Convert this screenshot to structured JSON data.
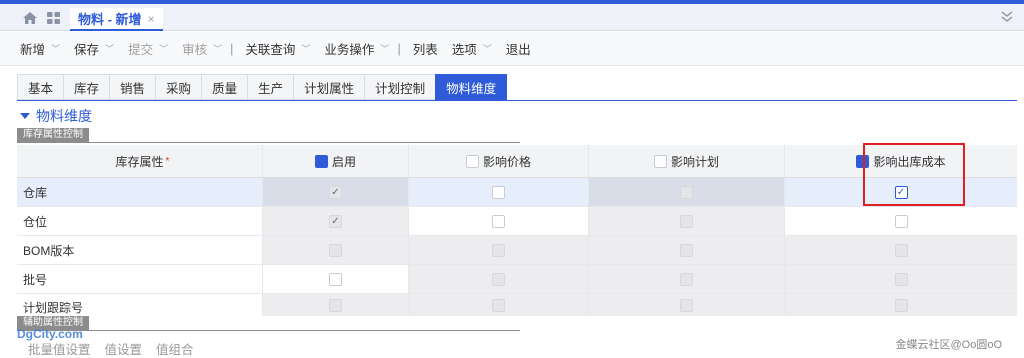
{
  "tabbar": {
    "doc_tab": "物料 - 新增",
    "close": "×"
  },
  "toolbar": [
    {
      "label": "新增",
      "dropdown": true,
      "disabled": false
    },
    {
      "label": "保存",
      "dropdown": true,
      "disabled": false
    },
    {
      "label": "提交",
      "dropdown": true,
      "disabled": true
    },
    {
      "label": "审核",
      "dropdown": true,
      "disabled": true
    },
    {
      "label": "关联查询",
      "dropdown": true,
      "disabled": false
    },
    {
      "label": "业务操作",
      "dropdown": true,
      "disabled": false
    },
    {
      "label": "列表",
      "dropdown": false,
      "disabled": false
    },
    {
      "label": "选项",
      "dropdown": true,
      "disabled": false
    },
    {
      "label": "退出",
      "dropdown": false,
      "disabled": false
    }
  ],
  "toolbar_sep": "|",
  "subtabs": [
    "基本",
    "库存",
    "销售",
    "采购",
    "质量",
    "生产",
    "计划属性",
    "计划控制",
    "物料维度"
  ],
  "active_subtab": "物料维度",
  "section_title": "物料维度",
  "group_inventory": "库存属性控制",
  "group_aux": "辅助属性控制",
  "grid": {
    "columns": [
      "库存属性",
      "启用",
      "影响价格",
      "影响计划",
      "影响出库成本"
    ],
    "required_mark": "*",
    "rows": [
      {
        "name": "仓库",
        "enabled": "checked-dis",
        "price": "empty",
        "plan": "dis",
        "cost": "checked"
      },
      {
        "name": "仓位",
        "enabled": "checked-dis",
        "price": "empty",
        "plan": "dis",
        "cost": "empty"
      },
      {
        "name": "BOM版本",
        "enabled": "dis",
        "price": "dis",
        "plan": "dis",
        "cost": "dis"
      },
      {
        "name": "批号",
        "enabled": "empty",
        "price": "dis",
        "plan": "dis",
        "cost": "dis"
      },
      {
        "name": "计划跟踪号",
        "enabled": "dis",
        "price": "dis",
        "plan": "dis",
        "cost": "dis"
      }
    ]
  },
  "sublinks": [
    "批量值设置",
    "值设置",
    "值组合"
  ],
  "watermark_left": "DgCity.com",
  "watermark_right": "金蝶云社区@Oo圆oO",
  "colors": {
    "accent": "#2f5bd8",
    "highlight": "#e02020"
  }
}
